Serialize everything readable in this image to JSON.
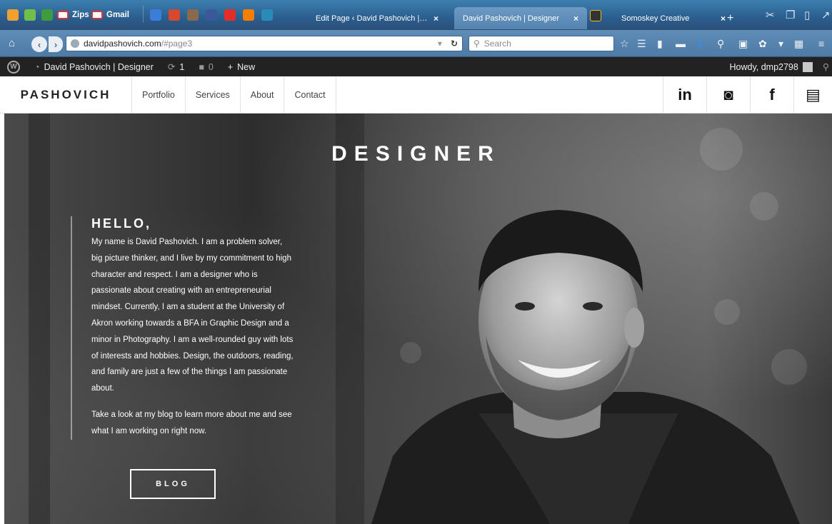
{
  "browser": {
    "bookmarks": [
      {
        "label": "Zips",
        "icon": "gmail-icon"
      },
      {
        "label": "Gmail",
        "icon": "gmail-icon"
      }
    ],
    "tabs": [
      {
        "label": "Edit Page ‹ David Pashovich | D...",
        "close": "×",
        "active": false
      },
      {
        "label": "David Pashovich | Designer",
        "close": "×",
        "active": true
      },
      {
        "label": "Somoskey Creative",
        "close": "×",
        "active": false
      }
    ],
    "new_tab": "+",
    "url_host": "davidpashovich.com",
    "url_path": "/#page3",
    "search_placeholder": "Search"
  },
  "wp_admin": {
    "site_name": "David Pashovich | Designer",
    "updates_count": "1",
    "comments_count": "0",
    "new_label": "New",
    "greeting": "Howdy, dmp2798"
  },
  "site": {
    "logo": "PASHOVICH",
    "nav": [
      "Portfolio",
      "Services",
      "About",
      "Contact"
    ],
    "social": [
      {
        "label": "in",
        "icon": "linkedin-icon"
      },
      {
        "label": "◙",
        "icon": "instagram-icon"
      },
      {
        "label": "f",
        "icon": "facebook-icon"
      },
      {
        "label": "▤",
        "icon": "resume-icon"
      }
    ]
  },
  "hero": {
    "headline": "DESIGNER",
    "greeting": "HELLO,",
    "bio": "My name is David Pashovich. I am a problem solver, big picture thinker, and I live by my commitment to high character and respect. I am a designer who is passionate about creating with an entrepreneurial mindset. Currently, I am a student at the University of Akron working towards a BFA in Graphic Design and a minor in Photography. I am a well-rounded guy with lots of interests and hobbies. Design, the outdoors, reading, and family are just a few of the things I am passionate about.",
    "cta_text": "Take a look at my blog to learn more about me and see what I am working on right now.",
    "button": "BLOG"
  }
}
